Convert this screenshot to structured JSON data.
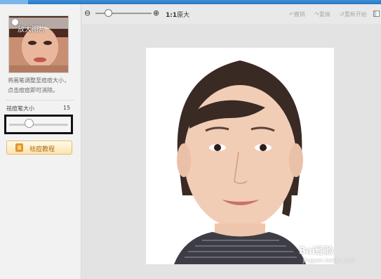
{
  "sidebar": {
    "thumbnail_label": "放大图片",
    "hint_lines": [
      "将画笔调整至痘痘大小，",
      "点击痘痘即可消除。"
    ],
    "brush_size_label": "祛痘笔大小",
    "brush_size_value": "15",
    "tutorial_button_label": "祛痘教程"
  },
  "toolbar": {
    "actual_size_ratio": "1:1",
    "actual_size_label": "原大",
    "undo_label": "撤销",
    "redo_label": "重做",
    "restart_label": "重新开始"
  },
  "watermark": {
    "text": "Bai经验",
    "subtext": "jingyan.baidu.com"
  }
}
